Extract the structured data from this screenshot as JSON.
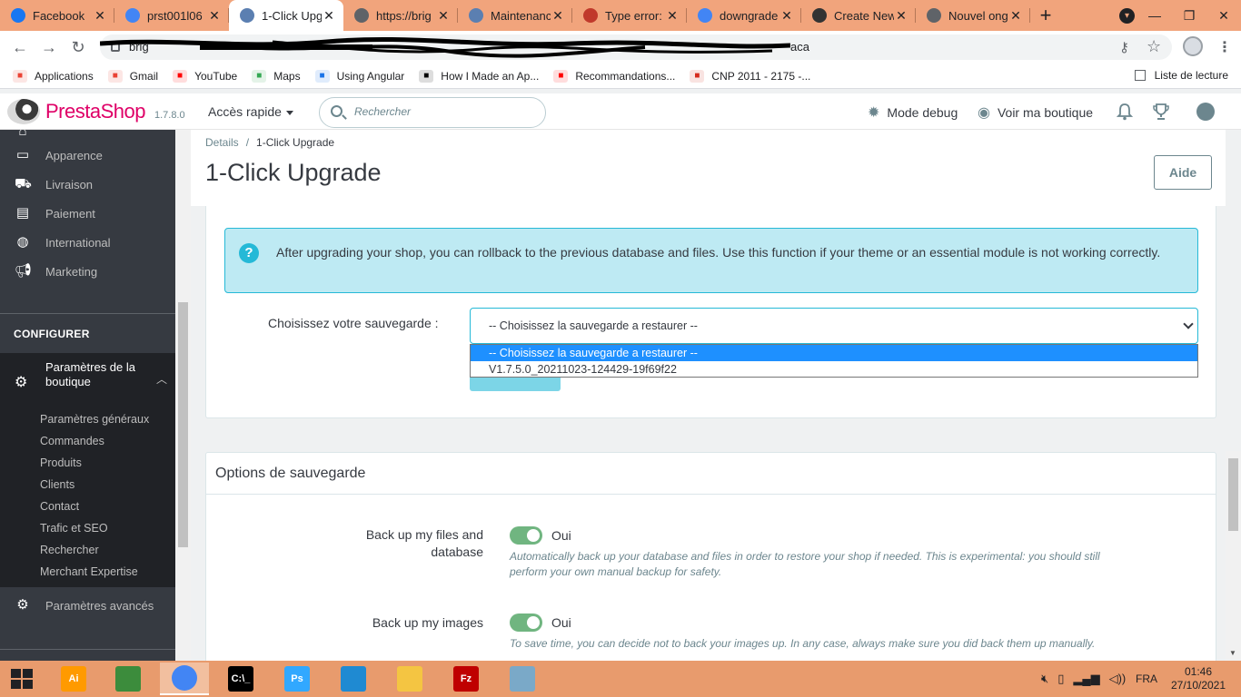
{
  "browser": {
    "tabs": [
      {
        "label": "Facebook",
        "favicon": "facebook-icon",
        "color": "#1877f2",
        "active": false
      },
      {
        "label": "prst001l06",
        "favicon": "google-icon",
        "color": "#4285f4",
        "active": false
      },
      {
        "label": "1-Click Upg",
        "favicon": "prestashop-icon",
        "color": "#5b7fb1",
        "active": true
      },
      {
        "label": "https://brig",
        "favicon": "globe-icon",
        "color": "#5f6368",
        "active": false
      },
      {
        "label": "Maintenanc",
        "favicon": "prestashop-icon",
        "color": "#5b7fb1",
        "active": false
      },
      {
        "label": "Type error:",
        "favicon": "error-icon",
        "color": "#c0392b",
        "active": false
      },
      {
        "label": "downgrade",
        "favicon": "google-icon",
        "color": "#4285f4",
        "active": false
      },
      {
        "label": "Create New",
        "favicon": "github-icon",
        "color": "#333333",
        "active": false
      },
      {
        "label": "Nouvel ong",
        "favicon": "chrome-icon",
        "color": "#5f6368",
        "active": false
      }
    ],
    "url": "brig",
    "url_tail": "aca",
    "reading_list": "Liste de lecture",
    "bookmarks": [
      {
        "label": "Applications",
        "icon": "apps-grid-icon",
        "color": "#ea4335"
      },
      {
        "label": "Gmail",
        "icon": "gmail-icon",
        "color": "#ea4335"
      },
      {
        "label": "YouTube",
        "icon": "youtube-icon",
        "color": "#ff0000"
      },
      {
        "label": "Maps",
        "icon": "maps-icon",
        "color": "#34a853"
      },
      {
        "label": "Using Angular",
        "icon": "angular-icon",
        "color": "#1a73e8"
      },
      {
        "label": "How I Made an Ap...",
        "icon": "medium-icon",
        "color": "#000000"
      },
      {
        "label": "Recommandations...",
        "icon": "youtube-icon",
        "color": "#ff0000"
      },
      {
        "label": "CNP 2011 - 2175 -...",
        "icon": "maple-leaf-icon",
        "color": "#d52b1e"
      }
    ]
  },
  "header": {
    "brand": "PrestaShop",
    "version": "1.7.8.0",
    "quick_access": "Accès rapide",
    "search_placeholder": "Rechercher",
    "debug": "Mode debug",
    "view_shop": "Voir ma boutique"
  },
  "sidebar": {
    "items": [
      {
        "label": "Apparence",
        "icon": "monitor-icon"
      },
      {
        "label": "Livraison",
        "icon": "truck-icon"
      },
      {
        "label": "Paiement",
        "icon": "credit-card-icon"
      },
      {
        "label": "International",
        "icon": "globe-icon"
      },
      {
        "label": "Marketing",
        "icon": "megaphone-icon"
      }
    ],
    "section": "CONFIGURER",
    "active": "Paramètres de la boutique",
    "sub_items": [
      "Paramètres généraux",
      "Commandes",
      "Produits",
      "Clients",
      "Contact",
      "Trafic et SEO",
      "Rechercher",
      "Merchant Expertise"
    ],
    "advanced": "Paramètres avancés"
  },
  "page": {
    "breadcrumb_parent": "Details",
    "breadcrumb_sep": "/",
    "breadcrumb_current": "1-Click Upgrade",
    "title": "1-Click Upgrade",
    "help_button": "Aide"
  },
  "rollback": {
    "alert": "After upgrading your shop, you can rollback to the previous database and files. Use this function if your theme or an essential module is not working correctly.",
    "select_label": "Choisissez votre sauvegarde :",
    "selected": "-- Choisissez la sauvegarde a restaurer --",
    "options": [
      "-- Choisissez la sauvegarde a restaurer --",
      "V1.7.5.0_20211023-124429-19f69f22"
    ]
  },
  "backup_options": {
    "title": "Options de sauvegarde",
    "items": [
      {
        "label": "Back up my files and database",
        "value": "Oui",
        "help": "Automatically back up your database and files in order to restore your shop if needed. This is experimental: you should still perform your own manual backup for safety."
      },
      {
        "label": "Back up my images",
        "value": "Oui",
        "help": "To save time, you can decide not to back your images up. In any case, always make sure you did back them up manually."
      }
    ]
  },
  "taskbar": {
    "apps": [
      {
        "label": "Ai",
        "icon": "illustrator-icon",
        "color": "#ff9a00"
      },
      {
        "label": "",
        "icon": "notepad-icon",
        "color": "#3c8c3c"
      },
      {
        "label": "",
        "icon": "chrome-icon",
        "color": "#4285f4"
      },
      {
        "label": "C:\\_",
        "icon": "terminal-icon",
        "color": "#000000"
      },
      {
        "label": "Ps",
        "icon": "photoshop-icon",
        "color": "#31a8ff"
      },
      {
        "label": "",
        "icon": "vscode-icon",
        "color": "#1f8ad2"
      },
      {
        "label": "",
        "icon": "file-explorer-icon",
        "color": "#f4c542"
      },
      {
        "label": "Fz",
        "icon": "filezilla-icon",
        "color": "#bf0000"
      },
      {
        "label": "",
        "icon": "notepad-plus-icon",
        "color": "#7aa9c8"
      }
    ],
    "lang": "FRA",
    "time": "01:46",
    "date": "27/10/2021"
  }
}
